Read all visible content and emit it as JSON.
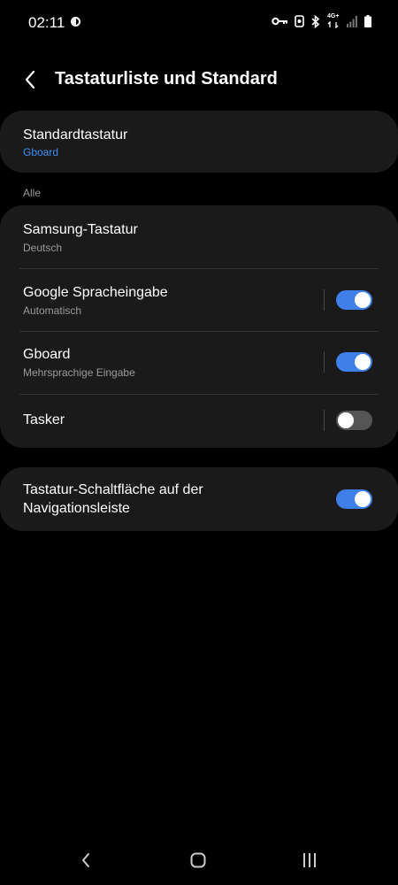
{
  "status_bar": {
    "time": "02:11",
    "network_label": "4G+",
    "icons": [
      "brightness-icon",
      "key-icon",
      "shield-icon",
      "bluetooth-icon",
      "network-icon",
      "signal-icon",
      "battery-icon"
    ]
  },
  "header": {
    "title": "Tastaturliste und Standard",
    "back_icon": "chevron-left-icon"
  },
  "default_keyboard": {
    "label": "Standardtastatur",
    "value": "Gboard"
  },
  "section": {
    "label": "Alle"
  },
  "keyboards": [
    {
      "title": "Samsung-Tastatur",
      "subtitle": "Deutsch",
      "has_toggle": false
    },
    {
      "title": "Google Spracheingabe",
      "subtitle": "Automatisch",
      "has_toggle": true,
      "enabled": true
    },
    {
      "title": "Gboard",
      "subtitle": "Mehrsprachige Eingabe",
      "has_toggle": true,
      "enabled": true
    },
    {
      "title": "Tasker",
      "subtitle": "",
      "has_toggle": true,
      "enabled": false
    }
  ],
  "nav_keyboard_button": {
    "line1": "Tastatur-Schaltfläche auf der",
    "line2": "Navigationsleiste",
    "enabled": true
  },
  "colors": {
    "accent": "#3e8ef7",
    "toggle_on": "#3e7fe8",
    "card_bg": "#1a1a1a",
    "background": "#000000"
  },
  "nav": {
    "icons": [
      "back-icon",
      "home-icon",
      "recents-icon"
    ]
  }
}
